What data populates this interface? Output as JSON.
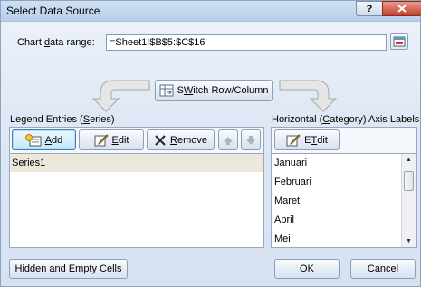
{
  "window": {
    "title": "Select Data Source",
    "help_label": "?",
    "close_label": "x"
  },
  "chart_range": {
    "label_prefix": "Chart ",
    "label_underlined": "d",
    "label_suffix": "ata range:",
    "value": "=Sheet1!$B$5:$C$16"
  },
  "switch_button": {
    "label_underlined": "W",
    "label_prefix": "S",
    "label_suffix": "itch Row/Column"
  },
  "legend": {
    "header_prefix": "Legend Entries (",
    "header_underlined": "S",
    "header_suffix": "eries)",
    "add_underlined": "A",
    "add_suffix": "dd",
    "edit_underlined": "E",
    "edit_suffix": "dit",
    "remove_underlined": "R",
    "remove_suffix": "emove",
    "series": [
      "Series1"
    ]
  },
  "axis": {
    "header_prefix": "Horizontal (",
    "header_underlined": "C",
    "header_suffix": "ategory) Axis Labels",
    "edit_underlined": "T",
    "edit_suffix": "dit",
    "edit_prefix": "E",
    "categories": [
      "Januari",
      "Februari",
      "Maret",
      "April",
      "Mei"
    ]
  },
  "footer": {
    "hidden_underlined": "H",
    "hidden_suffix": "idden and Empty Cells",
    "ok_label": "OK",
    "cancel_label": "Cancel"
  },
  "icons": {
    "add": "add-series-icon",
    "edit": "edit-pencil-icon",
    "remove": "remove-x-icon",
    "up": "move-up-icon",
    "down": "move-down-icon",
    "switch": "switch-row-column-icon",
    "collapse": "collapse-dialog-icon"
  }
}
